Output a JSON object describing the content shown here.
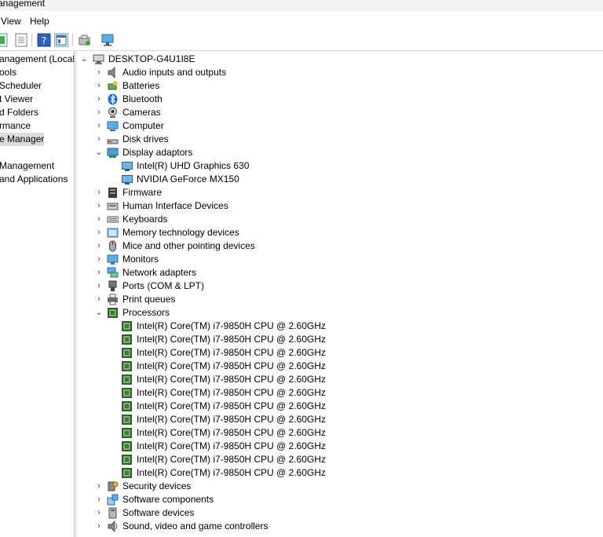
{
  "window": {
    "title": "anagement"
  },
  "menubar": {
    "items": [
      "View",
      "Help"
    ]
  },
  "toolbar": {
    "icons": [
      "back-icon",
      "properties-icon",
      "help-icon",
      "show-hide-tree-icon",
      "update-driver-icon",
      "scan-hardware-icon"
    ]
  },
  "left_tree": {
    "items": [
      "anagement (Local)",
      "ools",
      "Scheduler",
      "t Viewer",
      "d Folders",
      "rmance",
      "e Manager",
      "",
      "Management",
      "and Applications"
    ],
    "selected_index": 6
  },
  "device_tree": {
    "root": "DESKTOP-G4U1I8E",
    "categories": [
      {
        "label": "Audio inputs and outputs",
        "icon": "speaker-icon",
        "expanded": false
      },
      {
        "label": "Batteries",
        "icon": "battery-icon",
        "expanded": false
      },
      {
        "label": "Bluetooth",
        "icon": "bluetooth-icon",
        "expanded": false
      },
      {
        "label": "Cameras",
        "icon": "camera-icon",
        "expanded": false
      },
      {
        "label": "Computer",
        "icon": "computer-icon",
        "expanded": false
      },
      {
        "label": "Disk drives",
        "icon": "disk-drive-icon",
        "expanded": false
      },
      {
        "label": "Display adaptors",
        "icon": "display-adapter-icon",
        "expanded": true,
        "children": [
          "Intel(R) UHD Graphics 630",
          "NVIDIA GeForce MX150"
        ]
      },
      {
        "label": "Firmware",
        "icon": "firmware-icon",
        "expanded": false
      },
      {
        "label": "Human Interface Devices",
        "icon": "hid-icon",
        "expanded": false
      },
      {
        "label": "Keyboards",
        "icon": "keyboard-icon",
        "expanded": false
      },
      {
        "label": "Memory technology devices",
        "icon": "memory-icon",
        "expanded": false
      },
      {
        "label": "Mice and other pointing devices",
        "icon": "mouse-icon",
        "expanded": false
      },
      {
        "label": "Monitors",
        "icon": "monitor-icon",
        "expanded": false
      },
      {
        "label": "Network adapters",
        "icon": "network-icon",
        "expanded": false
      },
      {
        "label": "Ports (COM & LPT)",
        "icon": "port-icon",
        "expanded": false
      },
      {
        "label": "Print queues",
        "icon": "printer-icon",
        "expanded": false
      },
      {
        "label": "Processors",
        "icon": "processor-icon",
        "expanded": true,
        "children": [
          "Intel(R) Core(TM) i7-9850H CPU @ 2.60GHz",
          "Intel(R) Core(TM) i7-9850H CPU @ 2.60GHz",
          "Intel(R) Core(TM) i7-9850H CPU @ 2.60GHz",
          "Intel(R) Core(TM) i7-9850H CPU @ 2.60GHz",
          "Intel(R) Core(TM) i7-9850H CPU @ 2.60GHz",
          "Intel(R) Core(TM) i7-9850H CPU @ 2.60GHz",
          "Intel(R) Core(TM) i7-9850H CPU @ 2.60GHz",
          "Intel(R) Core(TM) i7-9850H CPU @ 2.60GHz",
          "Intel(R) Core(TM) i7-9850H CPU @ 2.60GHz",
          "Intel(R) Core(TM) i7-9850H CPU @ 2.60GHz",
          "Intel(R) Core(TM) i7-9850H CPU @ 2.60GHz",
          "Intel(R) Core(TM) i7-9850H CPU @ 2.60GHz"
        ]
      },
      {
        "label": "Security devices",
        "icon": "security-key-icon",
        "expanded": false
      },
      {
        "label": "Software components",
        "icon": "software-component-icon",
        "expanded": false
      },
      {
        "label": "Software devices",
        "icon": "software-device-icon",
        "expanded": false
      },
      {
        "label": "Sound, video and game controllers",
        "icon": "sound-icon",
        "expanded": false
      }
    ]
  },
  "colors": {
    "processor_green": "#3d7a3d",
    "monitor_blue": "#2a78c8",
    "selection_gray": "#dcdcdc"
  }
}
